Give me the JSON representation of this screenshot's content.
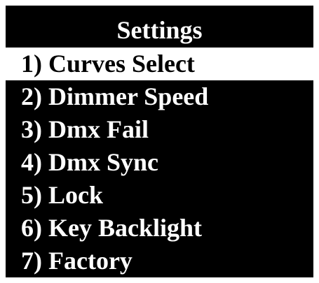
{
  "screen": {
    "title": "Settings",
    "selected_index": 0,
    "items": [
      {
        "label": "1) Curves Select"
      },
      {
        "label": "2) Dimmer Speed"
      },
      {
        "label": "3) Dmx Fail"
      },
      {
        "label": "4) Dmx Sync"
      },
      {
        "label": "5) Lock"
      },
      {
        "label": "6) Key Backlight"
      },
      {
        "label": "7) Factory"
      }
    ]
  },
  "colors": {
    "background": "#000000",
    "text": "#ffffff",
    "highlight": "#ffffff",
    "highlight_text": "#000000"
  }
}
